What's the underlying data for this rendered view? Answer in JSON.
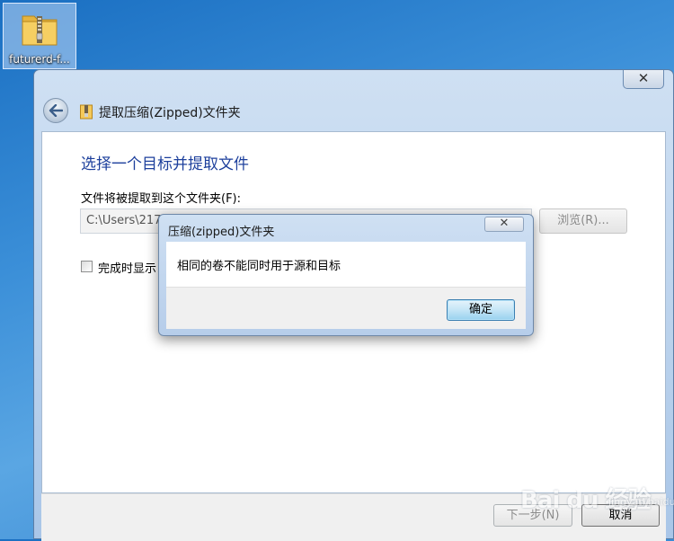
{
  "desktop": {
    "icon_label": "futurerd-f..."
  },
  "window": {
    "title": "提取压缩(Zipped)文件夹",
    "close_glyph": "✕",
    "heading": "选择一个目标并提取文件",
    "folder_label": "文件将被提取到这个文件夹(F):",
    "path_value": "C:\\Users\\217",
    "browse_label": "浏览(R)...",
    "checkbox_label": "完成时显示",
    "checkbox_checked": false,
    "next_label": "下一步(N)",
    "cancel_label": "取消"
  },
  "message_box": {
    "title": "压缩(zipped)文件夹",
    "close_glyph": "✕",
    "message": "相同的卷不能同时用于源和目标",
    "ok_label": "确定"
  },
  "watermark": {
    "brand": "Bai du 经验",
    "sub": "jingyan.baidu.com"
  },
  "colors": {
    "desktop": "#3b8fd8",
    "heading": "#1c3f9c",
    "ok_button": "#c4e5f6"
  }
}
